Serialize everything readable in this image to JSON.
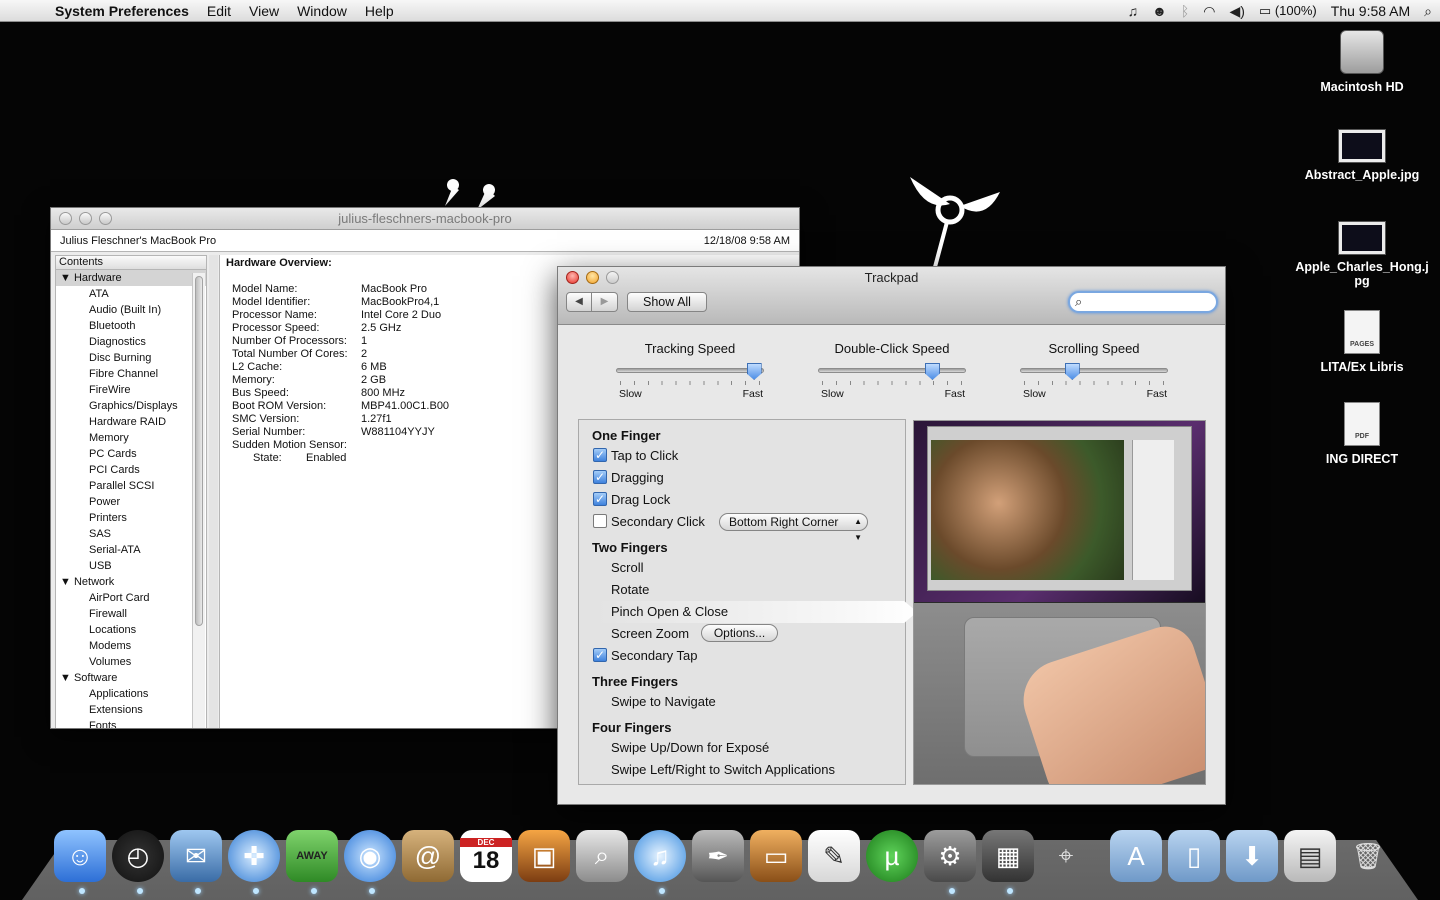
{
  "menubar": {
    "app": "System Preferences",
    "items": [
      "Edit",
      "View",
      "Window",
      "Help"
    ],
    "battery": "(100%)",
    "clock": "Thu 9:58 AM"
  },
  "desktop_icons": [
    {
      "label": "Macintosh HD"
    },
    {
      "label": "Abstract_Apple.jpg"
    },
    {
      "label": "Apple_Charles_Hong.jpg"
    },
    {
      "label": "LITA/Ex Libris",
      "badge": "PAGES"
    },
    {
      "label": "ING DIRECT",
      "badge": "PDF"
    }
  ],
  "profiler": {
    "title": "julius-fleschners-macbook-pro",
    "machine": "Julius Fleschner's MacBook Pro",
    "timestamp": "12/18/08 9:58 AM",
    "contents_header": "Contents",
    "groups": [
      {
        "label": "Hardware",
        "items": [
          "ATA",
          "Audio (Built In)",
          "Bluetooth",
          "Diagnostics",
          "Disc Burning",
          "Fibre Channel",
          "FireWire",
          "Graphics/Displays",
          "Hardware RAID",
          "Memory",
          "PC Cards",
          "PCI Cards",
          "Parallel SCSI",
          "Power",
          "Printers",
          "SAS",
          "Serial-ATA",
          "USB"
        ]
      },
      {
        "label": "Network",
        "items": [
          "AirPort Card",
          "Firewall",
          "Locations",
          "Modems",
          "Volumes"
        ]
      },
      {
        "label": "Software",
        "items": [
          "Applications",
          "Extensions",
          "Fonts"
        ]
      }
    ],
    "overview_heading": "Hardware Overview:",
    "overview": [
      {
        "k": "Model Name:",
        "v": "MacBook Pro"
      },
      {
        "k": "Model Identifier:",
        "v": "MacBookPro4,1"
      },
      {
        "k": "Processor Name:",
        "v": "Intel Core 2 Duo"
      },
      {
        "k": "Processor Speed:",
        "v": "2.5 GHz"
      },
      {
        "k": "Number Of Processors:",
        "v": "1"
      },
      {
        "k": "Total Number Of Cores:",
        "v": "2"
      },
      {
        "k": "L2 Cache:",
        "v": "6 MB"
      },
      {
        "k": "Memory:",
        "v": "2 GB"
      },
      {
        "k": "Bus Speed:",
        "v": "800 MHz"
      },
      {
        "k": "Boot ROM Version:",
        "v": "MBP41.00C1.B00"
      },
      {
        "k": "SMC Version:",
        "v": "1.27f1"
      },
      {
        "k": "Serial Number:",
        "v": "W881104YYJY"
      },
      {
        "k": "Sudden Motion Sensor:",
        "v": ""
      },
      {
        "k": "State:",
        "v": "Enabled"
      }
    ]
  },
  "trackpad": {
    "title": "Trackpad",
    "show_all": "Show All",
    "search_placeholder": "",
    "sliders": [
      {
        "label": "Tracking Speed",
        "min": "Slow",
        "max": "Fast",
        "value": 0.93
      },
      {
        "label": "Double-Click Speed",
        "min": "Slow",
        "max": "Fast",
        "value": 0.77
      },
      {
        "label": "Scrolling Speed",
        "min": "Slow",
        "max": "Fast",
        "value": 0.35
      }
    ],
    "one_finger": "One Finger",
    "tap_to_click": "Tap to Click",
    "dragging": "Dragging",
    "drag_lock": "Drag Lock",
    "secondary_click": "Secondary Click",
    "secondary_click_option": "Bottom Right Corner",
    "two_fingers": "Two Fingers",
    "scroll": "Scroll",
    "rotate": "Rotate",
    "pinch": "Pinch Open & Close",
    "screen_zoom": "Screen Zoom",
    "options": "Options...",
    "secondary_tap": "Secondary Tap",
    "three_fingers": "Three Fingers",
    "swipe_navigate": "Swipe to Navigate",
    "four_fingers": "Four Fingers",
    "swipe_expose": "Swipe Up/Down for Exposé",
    "swipe_switch": "Swipe Left/Right to Switch Applications",
    "checked": {
      "tap_to_click": true,
      "dragging": true,
      "drag_lock": true,
      "secondary_click": false,
      "secondary_tap": true
    }
  },
  "dock": {
    "calendar_month": "DEC",
    "calendar_day": "18",
    "adium_badge": "AWAY"
  },
  "colors": {
    "accent": "#4f8fe6",
    "desktop": "#050505"
  }
}
